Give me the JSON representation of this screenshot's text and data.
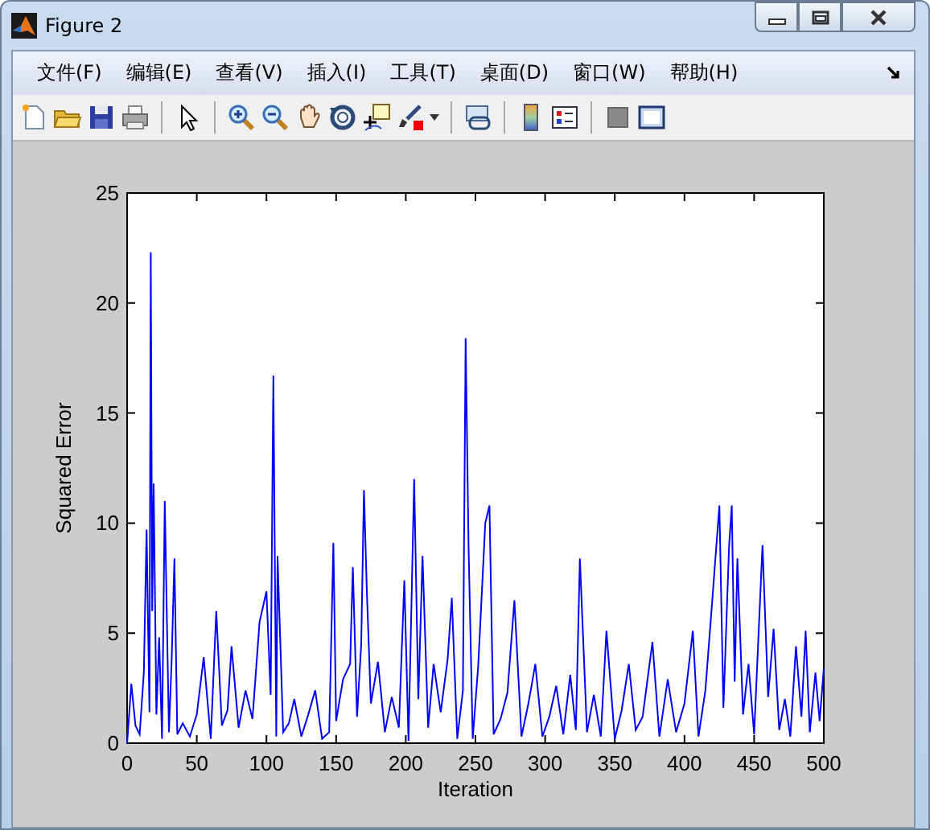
{
  "window": {
    "title": "Figure 2"
  },
  "menu": [
    {
      "label": "文件(F)"
    },
    {
      "label": "编辑(E)"
    },
    {
      "label": "查看(V)"
    },
    {
      "label": "插入(I)"
    },
    {
      "label": "工具(T)"
    },
    {
      "label": "桌面(D)"
    },
    {
      "label": "窗口(W)"
    },
    {
      "label": "帮助(H)"
    }
  ],
  "toolbar": [
    {
      "kind": "new"
    },
    {
      "kind": "open"
    },
    {
      "kind": "save"
    },
    {
      "kind": "print"
    },
    {
      "kind": "separator"
    },
    {
      "kind": "pointer"
    },
    {
      "kind": "separator"
    },
    {
      "kind": "zoom-in"
    },
    {
      "kind": "zoom-out"
    },
    {
      "kind": "pan"
    },
    {
      "kind": "rotate"
    },
    {
      "kind": "data-cursor"
    },
    {
      "kind": "brush"
    },
    {
      "kind": "separator"
    },
    {
      "kind": "link"
    },
    {
      "kind": "separator"
    },
    {
      "kind": "colorbar"
    },
    {
      "kind": "legend"
    },
    {
      "kind": "separator"
    },
    {
      "kind": "hide-tools"
    },
    {
      "kind": "show-tools"
    }
  ],
  "figure": {
    "chart_data": {
      "type": "line",
      "xlabel": "Iteration",
      "ylabel": "Squared Error",
      "xlim": [
        0,
        500
      ],
      "ylim": [
        0,
        25
      ],
      "xticks": [
        0,
        50,
        100,
        150,
        200,
        250,
        300,
        350,
        400,
        450,
        500
      ],
      "yticks": [
        0,
        5,
        10,
        15,
        20,
        25
      ],
      "x": [
        0,
        3,
        6,
        9,
        12,
        14,
        16,
        17,
        18,
        19,
        21,
        23,
        25,
        27,
        30,
        32,
        34,
        36,
        40,
        45,
        50,
        55,
        60,
        64,
        68,
        72,
        75,
        80,
        85,
        90,
        95,
        100,
        103,
        105,
        107,
        108,
        112,
        116,
        120,
        125,
        130,
        135,
        140,
        145,
        148,
        150,
        155,
        160,
        162,
        165,
        168,
        170,
        172,
        175,
        180,
        185,
        190,
        195,
        199,
        202,
        206,
        209,
        212,
        216,
        220,
        225,
        230,
        233,
        237,
        241,
        243,
        245,
        248,
        252,
        257,
        260,
        263,
        268,
        273,
        278,
        283,
        288,
        293,
        298,
        303,
        308,
        313,
        318,
        322,
        325,
        330,
        335,
        340,
        344,
        350,
        355,
        360,
        365,
        370,
        377,
        382,
        388,
        394,
        400,
        406,
        410,
        415,
        420,
        425,
        428,
        432,
        434,
        436,
        438,
        442,
        446,
        450,
        456,
        460,
        464,
        468,
        472,
        476,
        480,
        484,
        487,
        490,
        494,
        497,
        500
      ],
      "series": [
        {
          "color": "#0000ff",
          "values": [
            0,
            2.7,
            0.8,
            0.4,
            3.2,
            9.7,
            1.4,
            22.3,
            6,
            11.8,
            1.3,
            4.8,
            0.2,
            11,
            0.5,
            3.8,
            8.4,
            0.4,
            0.9,
            0.3,
            1.3,
            3.9,
            0.2,
            6,
            0.8,
            1.5,
            4.4,
            0.7,
            2.4,
            1.1,
            5.5,
            6.9,
            2.2,
            16.7,
            0.3,
            8.5,
            0.5,
            0.9,
            2,
            0.3,
            1.3,
            2.4,
            0.2,
            0.5,
            9.1,
            1,
            2.9,
            3.6,
            8,
            1.2,
            4.5,
            11.5,
            6.9,
            1.8,
            3.7,
            0.5,
            2.1,
            0.7,
            7.4,
            0.1,
            12,
            2,
            8.5,
            0.7,
            3.6,
            1.4,
            3.8,
            6.6,
            0.2,
            2.4,
            18.4,
            9,
            0.2,
            3.5,
            10,
            10.8,
            0.4,
            1.1,
            2.3,
            6.5,
            0.3,
            1.8,
            3.6,
            0.3,
            1.2,
            2.6,
            0.4,
            3.1,
            0.6,
            8.4,
            0.5,
            2.2,
            0.3,
            5.1,
            0.2,
            1.5,
            3.6,
            0.6,
            1.2,
            4.6,
            0.3,
            2.9,
            0.5,
            1.8,
            5.1,
            0.3,
            2.4,
            6.5,
            10.8,
            1.6,
            8.9,
            10.8,
            2.8,
            8.4,
            1.3,
            3.6,
            0.4,
            9,
            2.1,
            5.2,
            0.6,
            2,
            0.3,
            4.4,
            1.2,
            5.1,
            0.5,
            3.2,
            1,
            3.4
          ]
        }
      ]
    }
  }
}
